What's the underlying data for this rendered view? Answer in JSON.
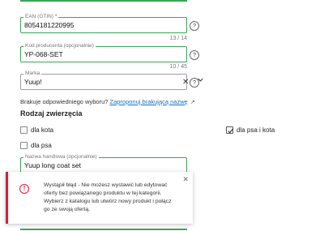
{
  "ean": {
    "label": "EAN (GTIN)",
    "required_mark": "*",
    "value": "8054181220995",
    "counter": "13 / 14"
  },
  "producer_code": {
    "label": "Kod producenta (opcjonalnie)",
    "value": "YP-068-SET",
    "counter": "10 / 45"
  },
  "brand": {
    "label": "Marka",
    "value": "Yuup!",
    "clear_icon": "close-icon",
    "dropdown_icon": "chevron-down-icon"
  },
  "help_glyph": "?",
  "missing_option": {
    "text": "Brakuje odpowiedniego wyboru?",
    "link": "Zaproponuj brakującą nazwę"
  },
  "animal_section": {
    "title": "Rodzaj zwierzęcia",
    "options": [
      {
        "label": "dla kota",
        "checked": false
      },
      {
        "label": "dla psa i kota",
        "checked": true
      },
      {
        "label": "dla psa",
        "checked": false
      }
    ]
  },
  "trade_name": {
    "label": "Nazwa handlowa (opcjonalnie)",
    "value": "Yuup long coat set"
  },
  "toast": {
    "message": "Wystąpił błąd - Nie możesz wystawić lub edytować oferty bez powiązanego produktu w tej kategorii. Wybierz z katalogu lub utwórz nowy produkt i połącz go ze swoją ofertą.",
    "warn_glyph": "!",
    "close_glyph": "✕"
  },
  "colors": {
    "accent_green": "#3aa557",
    "error_red": "#d81e3a",
    "link_blue": "#1a6fb8"
  }
}
